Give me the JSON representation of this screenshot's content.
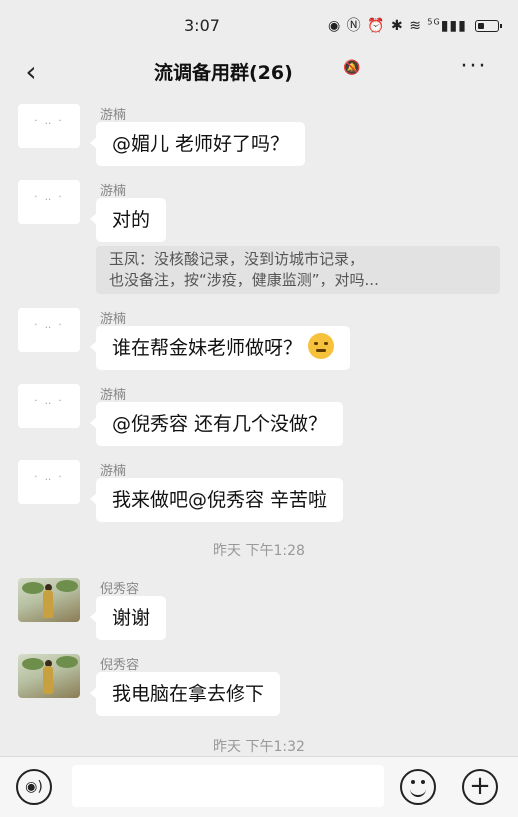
{
  "status": {
    "time": "3:07",
    "icons": [
      "eye-icon",
      "nfc-icon",
      "alarm-icon",
      "bluetooth-icon",
      "wifi-icon",
      "signal-icon",
      "battery-icon"
    ],
    "network": "5G"
  },
  "header": {
    "back_icon": "back-arrow-icon",
    "title": "流调备用群(26)",
    "mute_icon": "mute-bell-icon",
    "more_label": "···"
  },
  "messages": [
    {
      "sender": "游楠",
      "text": "@媚儿  老师好了吗？"
    },
    {
      "sender": "游楠",
      "text": "对的",
      "quote_line1": "玉凤：没核酸记录，没到访城市记录，",
      "quote_line2": "也没备注，按“涉疫，健康监测”，对吗..."
    },
    {
      "sender": "游楠",
      "text": "谁在帮金妹老师做呀？",
      "emoji": "thinking-face-emoji"
    },
    {
      "sender": "游楠",
      "text": "@倪秀容  还有几个没做？"
    },
    {
      "sender": "游楠",
      "text": "我来做吧@倪秀容  辛苦啦"
    },
    {
      "sender": "倪秀容",
      "text": "谢谢"
    },
    {
      "sender": "倪秀容",
      "text": "我电脑在拿去修下"
    }
  ],
  "time_labels": [
    "昨天 下午1:28",
    "昨天 下午1:32"
  ],
  "input_bar": {
    "voice_icon": "voice-icon",
    "placeholder": "",
    "value": "",
    "emoji_icon": "emoji-icon",
    "plus_icon": "plus-icon"
  }
}
